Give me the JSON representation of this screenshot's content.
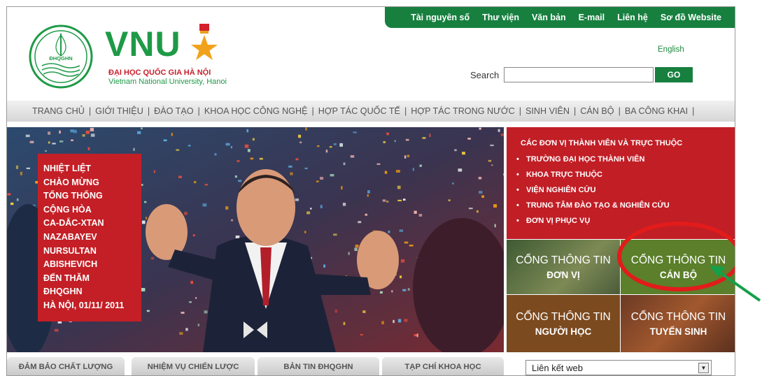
{
  "topnav": {
    "items": [
      "Tài nguyên số",
      "Thư viện",
      "Văn bản",
      "E-mail",
      "Liên hệ",
      "Sơ đồ Website"
    ]
  },
  "logo": {
    "seal_text": "ĐHQGHN",
    "brand": "VNU",
    "name_vn": "ĐẠI HỌC QUỐC GIA HÀ NỘI",
    "name_en": "Vietnam National University, Hanoi"
  },
  "header": {
    "language_link": "English",
    "search_label": "Search",
    "search_value": "",
    "go_label": "GO"
  },
  "mainmenu": {
    "items": [
      "TRANG CHỦ",
      "GIỚI THIỆU",
      "ĐÀO TẠO",
      "KHOA HỌC CÔNG NGHỆ",
      "HỢP TÁC QUỐC TẾ",
      "HỢP TÁC TRONG NƯỚC",
      "SINH VIÊN",
      "CÁN BỘ",
      "BA CÔNG KHAI"
    ],
    "separator": "|"
  },
  "banner": {
    "caption_lines": [
      "NHIỆT LIỆT",
      "CHÀO MỪNG",
      "TỔNG THỐNG",
      "CỘNG HÒA",
      "CA-DẮC-XTAN",
      "NAZABAYEV",
      "NURSULTAN",
      "ABISHEVICH",
      "ĐẾN THĂM",
      "ĐHQGHN",
      "HÀ NỘI, 01/11/ 2011"
    ]
  },
  "sidepanel": {
    "title": "CÁC ĐƠN VỊ THÀNH VIÊN VÀ TRỰC THUỘC",
    "items": [
      "TRƯỜNG ĐẠI HỌC THÀNH VIÊN",
      "KHOA TRỰC THUỘC",
      "VIỆN NGHIÊN CỨU",
      "TRUNG TÂM ĐÀO TẠO & NGHIÊN CỨU",
      "ĐƠN VỊ PHỤC VỤ"
    ]
  },
  "tiles": [
    {
      "line1": "CỔNG THÔNG TIN",
      "line2": "ĐƠN VỊ"
    },
    {
      "line1": "CỔNG THÔNG TIN",
      "line2": "CÁN BỘ"
    },
    {
      "line1": "CỔNG THÔNG TIN",
      "line2": "NGƯỜI HỌC"
    },
    {
      "line1": "CỔNG THÔNG TIN",
      "line2": "TUYỂN SINH"
    }
  ],
  "bottom": {
    "tabs": [
      "ĐẢM BẢO CHẤT LƯỢNG",
      "NHIỆM VỤ CHIẾN LƯỢC",
      "BẢN TIN ĐHQGHN",
      "TẠP CHÍ KHOA HỌC"
    ],
    "select_value": "Liên kết web"
  },
  "colors": {
    "brand_green": "#17803f",
    "brand_red": "#c11e26",
    "highlight_red": "#e21b1b",
    "arrow_green": "#14a04a"
  }
}
